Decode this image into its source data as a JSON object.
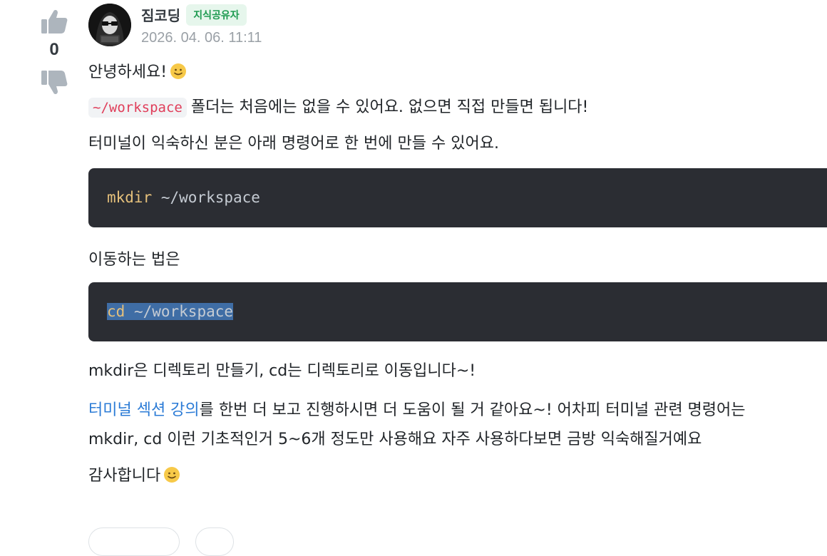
{
  "vote": {
    "count": "0",
    "upvote_icon": "thumbs-up-icon",
    "downvote_icon": "thumbs-down-icon"
  },
  "author": {
    "name": "짐코딩",
    "badge": "지식공유자",
    "date": "2026. 04. 06. 11:11",
    "avatar_icon": "hacker-avatar"
  },
  "answer": {
    "greeting": "안녕하세요!",
    "folder_code": "~/workspace",
    "folder_text": "폴더는 처음에는 없을 수 있어요. 없으면 직접 만들면 됩니다!",
    "terminal_text": "터미널이 익숙하신 분은 아래 명령어로 한 번에 만들 수 있어요.",
    "code1_cmd": "mkdir",
    "code1_arg": " ~/workspace",
    "move_text": "이동하는 법은",
    "code2_cmd": "cd",
    "code2_arg": " ~/workspace",
    "explain_text": "mkdir은 디렉토리 만들기, cd는 디렉토리로 이동입니다~!",
    "lecture_link": "터미널 섹션 강의",
    "lecture_line1": "를 한번 더 보고 진행하시면 더 도움이 될 거 같아요~! 어차피 터미널 관련 명령어는",
    "lecture_line2": "mkdir, cd 이런 기초적인거 5~6개 정도만 사용해요 자주 사용하다보면 금방 익숙해질거예요",
    "thanks": "감사합니다"
  },
  "colors": {
    "badge_bg": "#e6f6ec",
    "badge_text": "#1d9a50",
    "link": "#2b7bd6",
    "code_bg": "#2b2d33",
    "inline_code": "#e03e5a"
  }
}
